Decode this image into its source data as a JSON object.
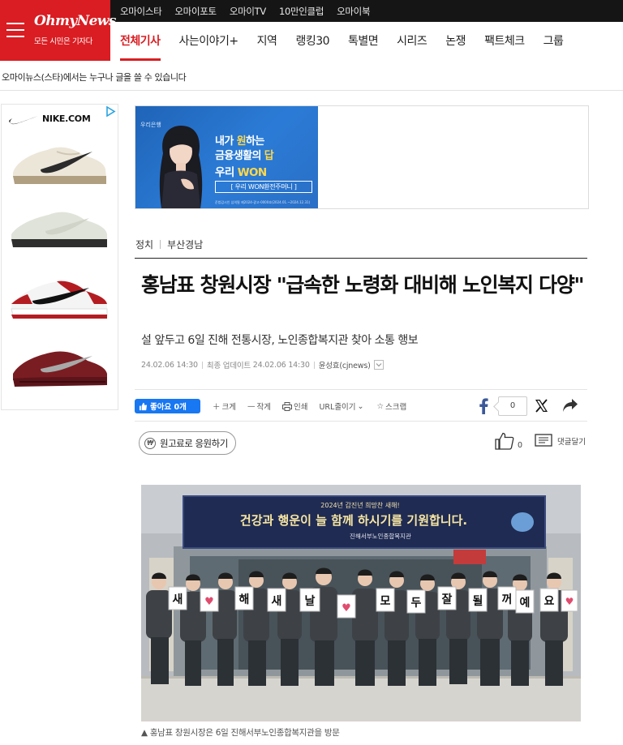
{
  "header": {
    "logo_text": "OhmyNews",
    "logo_slogan": "모든 시민은 기자다",
    "top_links": [
      "오마이스타",
      "오마이포토",
      "오마이TV",
      "10만인클럽",
      "오마이북"
    ],
    "nav": [
      "전체기사",
      "사는이야기+",
      "지역",
      "랭킹30",
      "톡별면",
      "시리즈",
      "논쟁",
      "팩트체크",
      "그룹"
    ],
    "notice": "오마이뉴스(스타)에서는 누구나 글을 쓸 수 있습니다"
  },
  "side_ad": {
    "brand": "NIKE.COM",
    "shoe_colors": [
      "#e8e2d6",
      "#dfe3da",
      "#b31d22",
      "#7a1d22"
    ]
  },
  "banner_ad": {
    "bank": "우리은행",
    "line1_a": "내가 ",
    "line1_hl": "원",
    "line1_b": "하는",
    "line2_a": "금융생활의 ",
    "line2_hl": "답",
    "line3_a": "우리 ",
    "line3_hl": "WON",
    "cta": "[ 우리 WON환전주머니 ]",
    "fine_print": "준법감시인 심의필 제2024-광고-0000호(2024.01.~2024.12.31)"
  },
  "article": {
    "section_1": "정치",
    "section_2": "부산경남",
    "headline": "홍남표 창원시장 \"급속한 노령화 대비해 노인복지 다양\"",
    "subhead": "설 앞두고 6일 진해 전통시장, 노인종합복지관 찾아 소통 행보",
    "published": "24.02.06 14:30",
    "updated_label": "최종 업데이트",
    "updated": "24.02.06 14:30",
    "author": "윤성효(cjnews)"
  },
  "toolbar": {
    "like_label": "좋아요 0개",
    "font_up": "크게",
    "font_down": "작게",
    "print": "인쇄",
    "url_copy": "URL줄이기",
    "scrap": "스크랩",
    "fb_count": "0"
  },
  "actions": {
    "support": "원고료로 응원하기",
    "like_count": "0",
    "comment": "댓글달기"
  },
  "photo": {
    "banner_small": "2024년 갑진년 희망찬 새해!",
    "banner_main": "건강과 행운이 늘 함께 하시기를 기원합니다.",
    "banner_org": "진해서부노인종합복지관",
    "cards": [
      "새",
      "♥",
      "해",
      "새",
      "날",
      "♥",
      "모",
      "두",
      "잘",
      "될",
      "꺼",
      "예",
      "요",
      "♥"
    ],
    "caption": "▲  홍남표 창원시장은 6일 진해서부노인종합복지관을 방문"
  }
}
